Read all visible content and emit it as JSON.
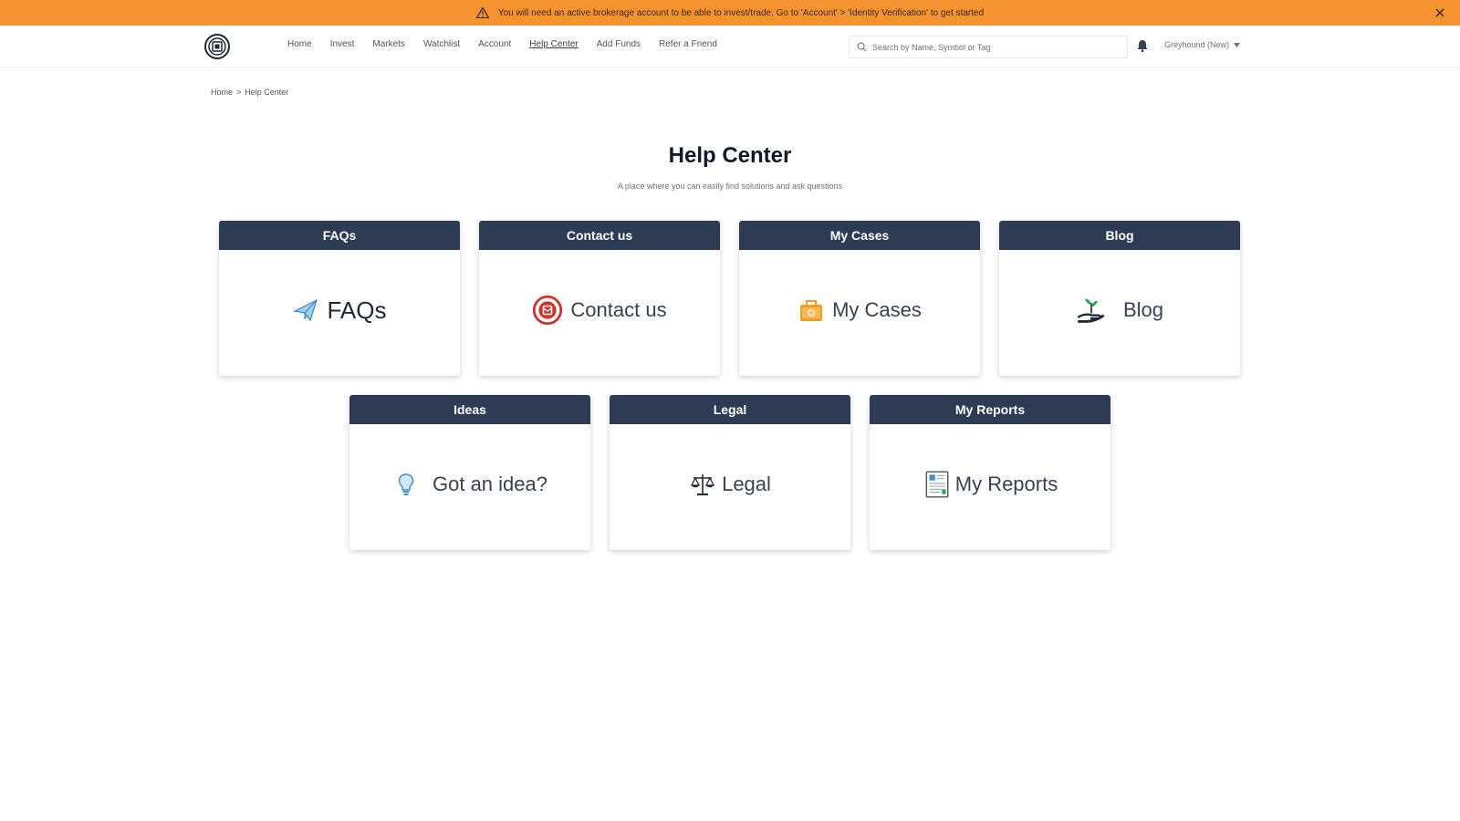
{
  "banner": {
    "message": "You will need an active brokerage account to be able to invest/trade. Go to 'Account' > 'Identity Verification' to get started",
    "color": "#f59331"
  },
  "header": {
    "nav": [
      {
        "label": "Home",
        "active": false
      },
      {
        "label": "Invest",
        "active": false
      },
      {
        "label": "Markets",
        "active": false
      },
      {
        "label": "Watchlist",
        "active": false
      },
      {
        "label": "Account",
        "active": false
      },
      {
        "label": "Help Center",
        "active": true
      },
      {
        "label": "Add Funds",
        "active": false
      },
      {
        "label": "Refer a Friend",
        "active": false
      }
    ],
    "search_placeholder": "Search by Name, Symbol or Tag",
    "user_label": "Greyhound (New)"
  },
  "breadcrumb": {
    "home": "Home",
    "separator": ">",
    "current": "Help Center"
  },
  "page": {
    "title": "Help Center",
    "subtitle": "A place where you can easily find solutions and ask questions"
  },
  "cards": [
    {
      "header": "FAQs",
      "label": "FAQs",
      "icon": "paper-plane-icon"
    },
    {
      "header": "Contact us",
      "label": "Contact us",
      "icon": "contact-icon"
    },
    {
      "header": "My Cases",
      "label": "My Cases",
      "icon": "briefcase-icon"
    },
    {
      "header": "Blog",
      "label": "Blog",
      "icon": "plant-hand-icon"
    },
    {
      "header": "Ideas",
      "label": "Got an idea?",
      "icon": "lightbulb-icon"
    },
    {
      "header": "Legal",
      "label": "Legal",
      "icon": "scales-icon"
    },
    {
      "header": "My Reports",
      "label": "My Reports",
      "icon": "report-icon"
    }
  ],
  "colors": {
    "card_header": "#2e3b55",
    "accent_orange": "#f59331"
  }
}
